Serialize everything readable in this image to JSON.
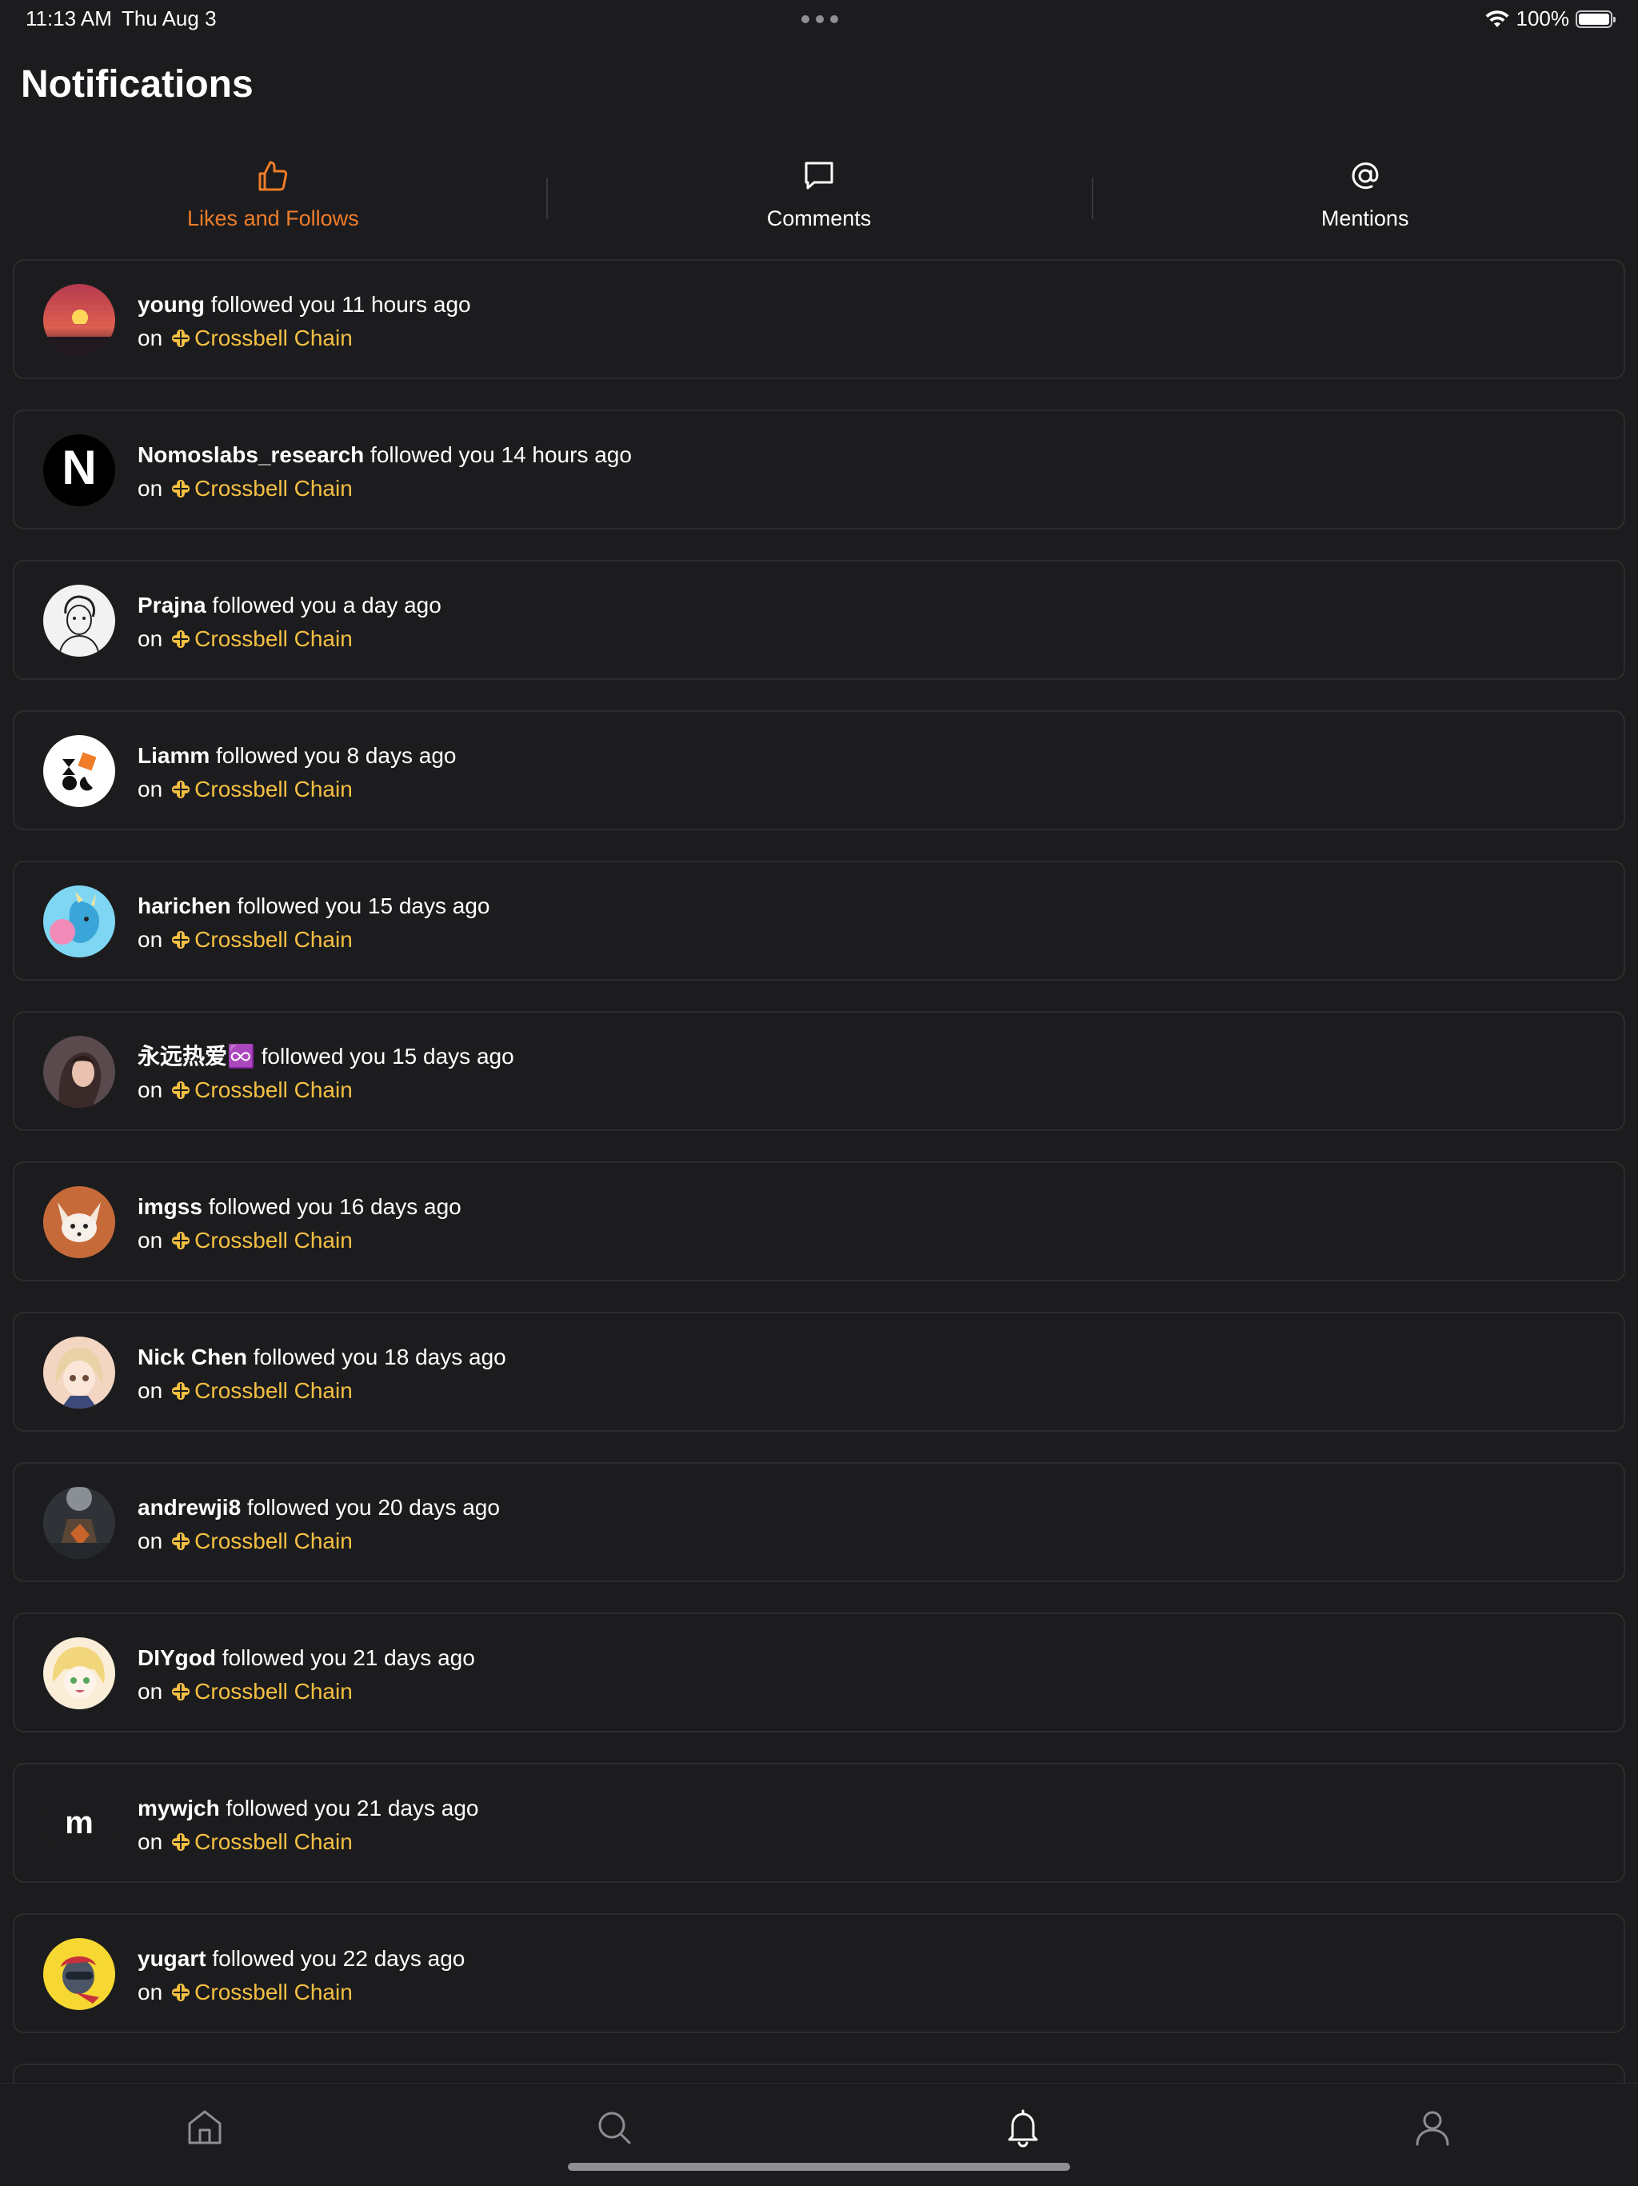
{
  "status_bar": {
    "time": "11:13 AM",
    "date": "Thu Aug 3",
    "battery": "100%"
  },
  "page_title": "Notifications",
  "tabs": [
    {
      "label": "Likes and Follows",
      "icon": "thumbs-up-icon",
      "active": true
    },
    {
      "label": "Comments",
      "icon": "comment-icon",
      "active": false
    },
    {
      "label": "Mentions",
      "icon": "at-icon",
      "active": false
    }
  ],
  "colors": {
    "accent": "#f07d2a",
    "chain": "#f5c042",
    "background": "#1c1c1e",
    "card_border": "#2c2c2e"
  },
  "notifications": [
    {
      "user": "young",
      "action": "followed you 11 hours ago",
      "on": "on",
      "chain": "Crossbell Chain"
    },
    {
      "user": "Nomoslabs_research",
      "action": "followed you 14 hours ago",
      "on": "on",
      "chain": "Crossbell Chain"
    },
    {
      "user": "Prajna",
      "action": "followed you a day ago",
      "on": "on",
      "chain": "Crossbell Chain"
    },
    {
      "user": "Liamm",
      "action": "followed you 8 days ago",
      "on": "on",
      "chain": "Crossbell Chain"
    },
    {
      "user": "harichen",
      "action": "followed you 15 days ago",
      "on": "on",
      "chain": "Crossbell Chain"
    },
    {
      "user": "永远热爱♾️",
      "action": "followed you 15 days ago",
      "on": "on",
      "chain": "Crossbell Chain"
    },
    {
      "user": "imgss",
      "action": "followed you 16 days ago",
      "on": "on",
      "chain": "Crossbell Chain"
    },
    {
      "user": "Nick Chen",
      "action": "followed you 18 days ago",
      "on": "on",
      "chain": "Crossbell Chain"
    },
    {
      "user": "andrewji8",
      "action": "followed you 20 days ago",
      "on": "on",
      "chain": "Crossbell Chain"
    },
    {
      "user": "DIYgod",
      "action": "followed you 21 days ago",
      "on": "on",
      "chain": "Crossbell Chain"
    },
    {
      "user": "mywjch",
      "action": "followed you 21 days ago",
      "on": "on",
      "chain": "Crossbell Chain"
    },
    {
      "user": "yugart",
      "action": "followed you 22 days ago",
      "on": "on",
      "chain": "Crossbell Chain"
    }
  ],
  "avatar_letters": {
    "nomoslabs": "N",
    "mywjch": "m"
  },
  "tab_bar": [
    {
      "icon": "home-icon"
    },
    {
      "icon": "search-icon"
    },
    {
      "icon": "bell-icon"
    },
    {
      "icon": "person-icon"
    }
  ]
}
